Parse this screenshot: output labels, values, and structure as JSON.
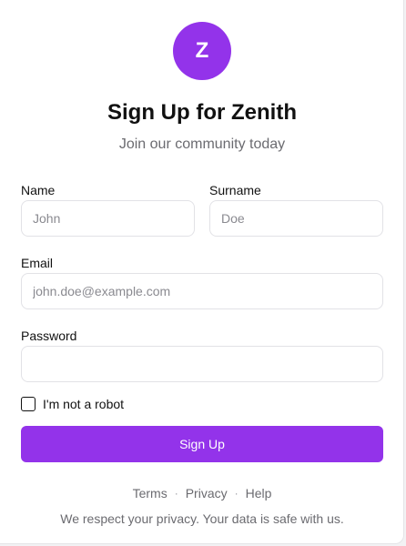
{
  "brand": {
    "logo_letter": "Z",
    "accent_color": "#9333ea"
  },
  "header": {
    "title": "Sign Up for Zenith",
    "subtitle": "Join our community today"
  },
  "form": {
    "name": {
      "label": "Name",
      "value": "",
      "placeholder": "John"
    },
    "surname": {
      "label": "Surname",
      "value": "",
      "placeholder": "Doe"
    },
    "email": {
      "label": "Email",
      "value": "",
      "placeholder": "john.doe@example.com"
    },
    "password": {
      "label": "Password",
      "value": "",
      "placeholder": ""
    },
    "robot_check": {
      "label": "I'm not a robot",
      "checked": false
    },
    "submit_label": "Sign Up"
  },
  "footer": {
    "links": [
      "Terms",
      "Privacy",
      "Help"
    ],
    "separator": "·",
    "note": "We respect your privacy. Your data is safe with us."
  }
}
